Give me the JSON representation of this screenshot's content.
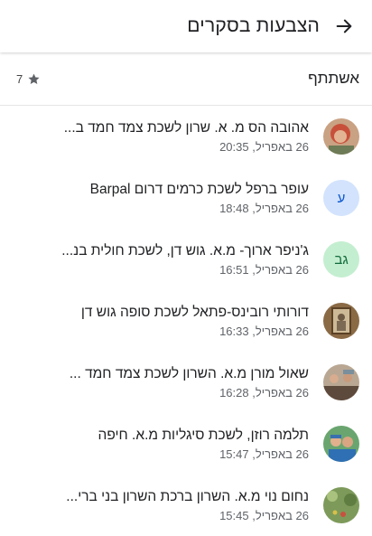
{
  "header": {
    "title": "הצבעות בסקרים"
  },
  "participants": {
    "label": "אשתתף",
    "count": "7"
  },
  "items": [
    {
      "name": "אהובה הס מ. א. שרון לשכת צמד חמד ב...",
      "time": "26 באפריל, 20:35",
      "avatar_type": "photo",
      "avatar_initials": ""
    },
    {
      "name": "עופר ברפל לשכת כרמים דרום Barpal",
      "time": "26 באפריל, 18:48",
      "avatar_type": "initials",
      "avatar_initials": "ע"
    },
    {
      "name": "ג'ניפר ארוך- מ.א. גוש דן, לשכת חולית בנ...",
      "time": "26 באפריל, 16:51",
      "avatar_type": "initials",
      "avatar_initials": "גב"
    },
    {
      "name": "דורותי רובינס-פתאל לשכת סופה גוש דן",
      "time": "26 באפריל, 16:33",
      "avatar_type": "photo",
      "avatar_initials": ""
    },
    {
      "name": "שאול מורן מ.א. השרון לשכת צמד חמד ...",
      "time": "26 באפריל, 16:28",
      "avatar_type": "photo",
      "avatar_initials": ""
    },
    {
      "name": "תלמה רוזן, לשכת סיגליות מ.א. חיפה",
      "time": "26 באפריל, 15:47",
      "avatar_type": "photo",
      "avatar_initials": ""
    },
    {
      "name": "נחום נוי מ.א. השרון ברכת השרון בני ברי...",
      "time": "26 באפריל, 15:45",
      "avatar_type": "photo",
      "avatar_initials": ""
    }
  ],
  "colors": {
    "initials_blue_bg": "#d3e3fd",
    "initials_blue_fg": "#0b57d0",
    "initials_teal_bg": "#c4eed0",
    "initials_teal_fg": "#0f6b3a"
  }
}
